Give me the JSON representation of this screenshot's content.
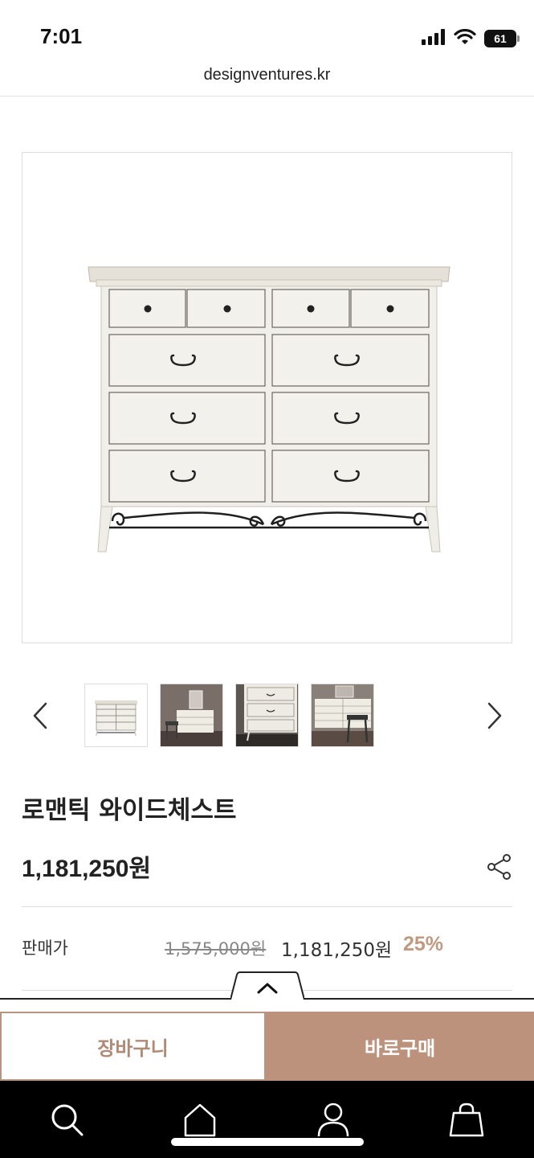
{
  "status_bar": {
    "time": "7:01",
    "battery_level": "61",
    "icons": [
      "cellular-signal-icon",
      "wifi-icon",
      "battery-icon"
    ]
  },
  "browser": {
    "url": "designventures.kr"
  },
  "gallery": {
    "main_image": "white-wide-chest-of-drawers",
    "thumbnails": [
      {
        "name": "chest-front-thumbnail",
        "selected": true
      },
      {
        "name": "chest-room-thumbnail",
        "selected": false
      },
      {
        "name": "chest-drawer-closeup-thumbnail",
        "selected": false
      },
      {
        "name": "chest-with-stool-thumbnail",
        "selected": false
      }
    ],
    "prev_icon": "chevron-left-icon",
    "next_icon": "chevron-right-icon"
  },
  "product": {
    "title": "로맨틱 와이드체스트",
    "price": "1,181,250원",
    "share_icon": "share-icon",
    "price_row": {
      "label": "판매가",
      "original": "1,575,000원",
      "sale": "1,181,250원",
      "discount": "25%"
    }
  },
  "collapse_icon": "chevron-up-icon",
  "actions": {
    "cart_label": "장바구니",
    "buy_label": "바로구매"
  },
  "bottom_nav": {
    "items": [
      "search-icon",
      "home-icon",
      "user-icon",
      "shopping-bag-icon"
    ]
  },
  "colors": {
    "accent": "#bd927c",
    "accent_text": "#b08a76",
    "discount": "#c09a80",
    "nav_bg": "#000000"
  }
}
